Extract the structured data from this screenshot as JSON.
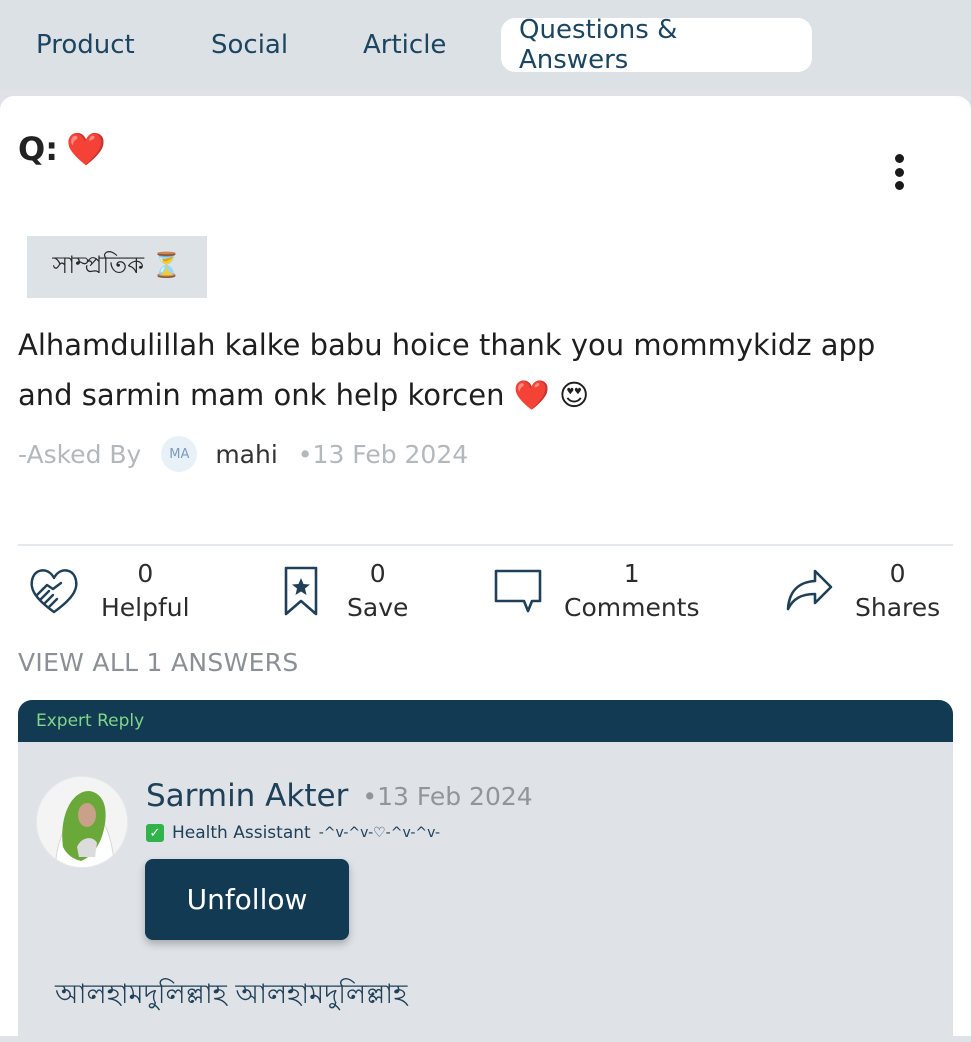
{
  "tabs": [
    {
      "label": "Product"
    },
    {
      "label": "Social"
    },
    {
      "label": "Article"
    },
    {
      "label": "Questions & Answers"
    }
  ],
  "question": {
    "prefix": "Q:",
    "title_emoji": "❤️",
    "tag": "সাম্প্রতিক ⏳",
    "body_line1": "Alhamdulillah kalke babu hoice thank you  mommykidz app",
    "body_line2": "and sarmin mam onk help korcen ❤️ 😍",
    "asked_by_label": "-Asked By",
    "asker_initials": "MA",
    "asker_name": "mahi",
    "date": "•13 Feb 2024"
  },
  "actions": {
    "helpful": {
      "count": "0",
      "label": "Helpful"
    },
    "save": {
      "count": "0",
      "label": "Save"
    },
    "comments": {
      "count": "1",
      "label": "Comments"
    },
    "shares": {
      "count": "0",
      "label": "Shares"
    }
  },
  "view_all_label": "VIEW ALL 1 ANSWERS",
  "reply": {
    "header": "Expert Reply",
    "name": "Sarmin Akter",
    "date": "•13 Feb 2024",
    "role": "Health Assistant",
    "role_decoration": "-^v-^v-♡-^v-^v-",
    "unfollow_label": "Unfollow",
    "text": "আলহামদুলিল্লাহ আলহামদুলিল্লাহ"
  },
  "colors": {
    "primary": "#123a52",
    "expert_label": "#7fd787",
    "heart": "#e0202c",
    "background": "#dfe3e8"
  }
}
